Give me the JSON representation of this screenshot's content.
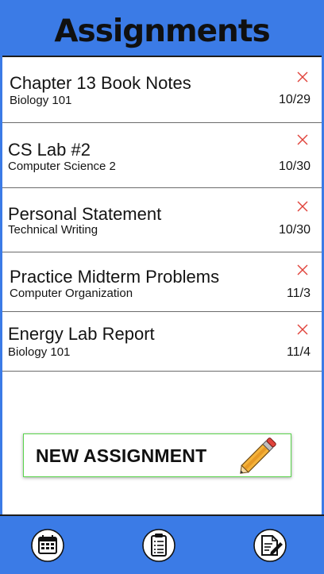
{
  "header": {
    "title": "Assignments"
  },
  "assignments": [
    {
      "title": "Chapter 13 Book Notes",
      "course": "Biology 101",
      "due": "10/29"
    },
    {
      "title": "CS Lab #2",
      "course": "Computer Science 2",
      "due": "10/30"
    },
    {
      "title": "Personal Statement",
      "course": "Technical Writing",
      "due": "10/30"
    },
    {
      "title": "Practice Midterm Problems",
      "course": "Computer Organization",
      "due": "11/3"
    },
    {
      "title": "Energy Lab Report",
      "course": "Biology 101",
      "due": "11/4"
    }
  ],
  "new_button": {
    "label": "NEW ASSIGNMENT"
  },
  "nav": {
    "items": [
      {
        "icon": "calendar-icon"
      },
      {
        "icon": "clipboard-icon"
      },
      {
        "icon": "edit-document-icon"
      }
    ]
  },
  "colors": {
    "accent": "#3b7be6",
    "delete": "#e0433b",
    "button_border": "#59d44b"
  }
}
